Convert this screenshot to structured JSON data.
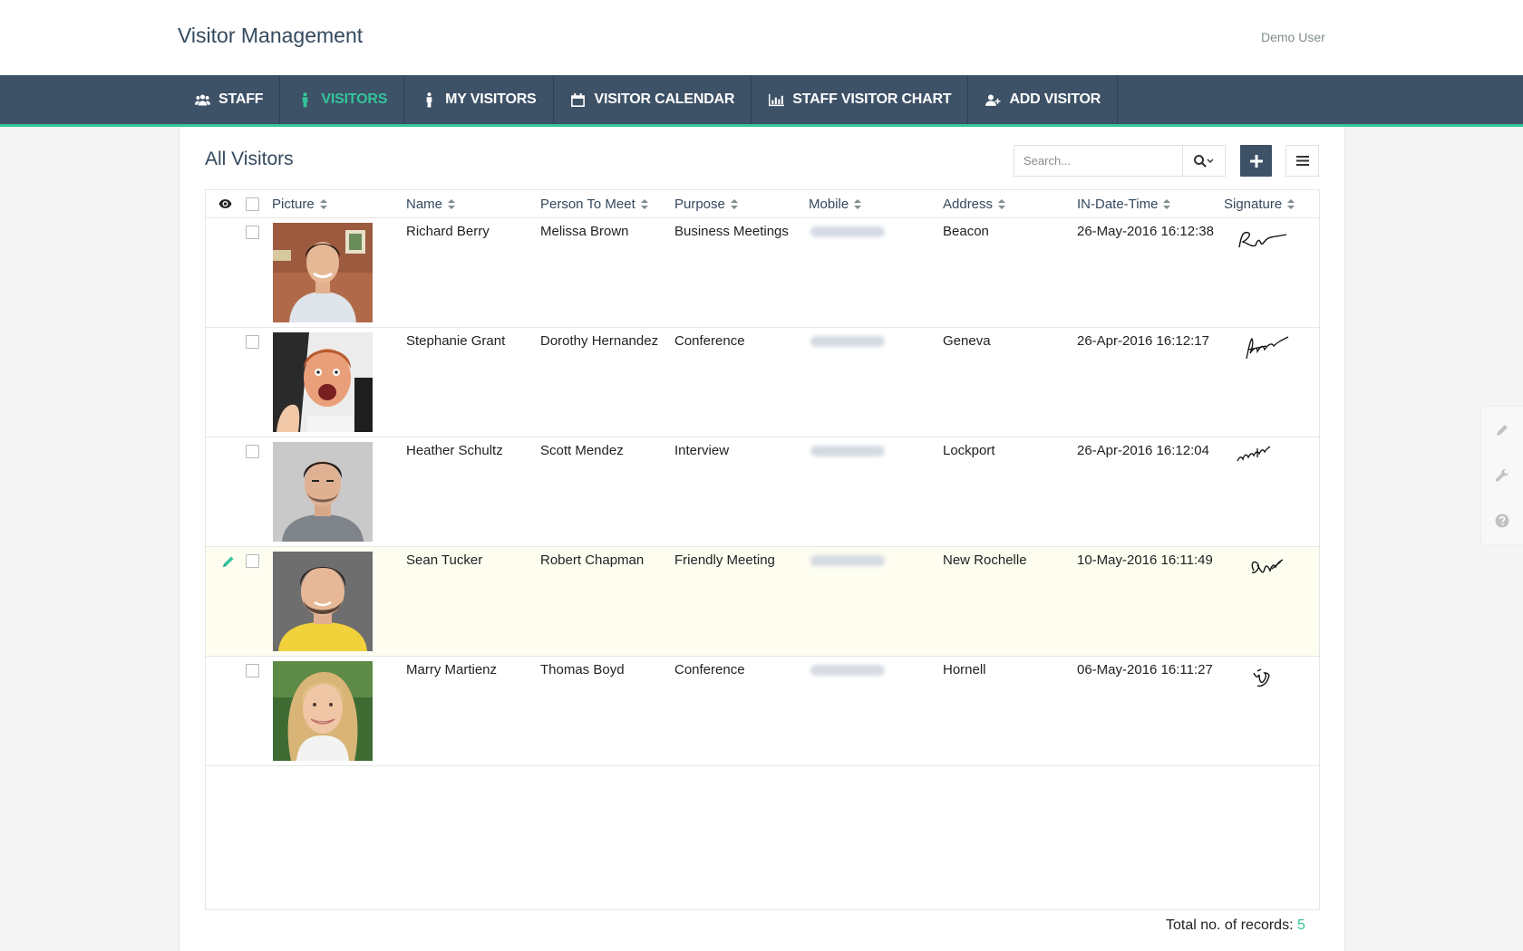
{
  "app": {
    "title": "Visitor Management",
    "user": "Demo User"
  },
  "nav": [
    {
      "label": "STAFF",
      "icon": "users-icon",
      "active": false
    },
    {
      "label": "VISITORS",
      "icon": "person-icon",
      "active": true
    },
    {
      "label": "MY VISITORS",
      "icon": "person-icon",
      "active": false
    },
    {
      "label": "VISITOR CALENDAR",
      "icon": "calendar-icon",
      "active": false
    },
    {
      "label": "STAFF VISITOR CHART",
      "icon": "bar-chart-icon",
      "active": false
    },
    {
      "label": "ADD VISITOR",
      "icon": "user-plus-icon",
      "active": false
    }
  ],
  "panel": {
    "title": "All Visitors",
    "search_placeholder": "Search...",
    "search_value": ""
  },
  "columns": [
    "Picture",
    "Name",
    "Person To Meet",
    "Purpose",
    "Mobile",
    "Address",
    "IN-Date-Time",
    "Signature"
  ],
  "rows": [
    {
      "name": "Richard Berry",
      "person_to_meet": "Melissa Brown",
      "purpose": "Business Meetings",
      "mobile": "6585346728",
      "address": "Beacon",
      "in_datetime": "26-May-2016 16:12:38",
      "highlighted": false,
      "checked": false
    },
    {
      "name": "Stephanie Grant",
      "person_to_meet": "Dorothy Hernandez",
      "purpose": "Conference",
      "mobile": "6587728286",
      "address": "Geneva",
      "in_datetime": "26-Apr-2016 16:12:17",
      "highlighted": false,
      "checked": false
    },
    {
      "name": "Heather Schultz",
      "person_to_meet": "Scott Mendez",
      "purpose": "Interview",
      "mobile": "6585728874",
      "address": "Lockport",
      "in_datetime": "26-Apr-2016 16:12:04",
      "highlighted": false,
      "checked": false
    },
    {
      "name": "Sean Tucker",
      "person_to_meet": "Robert Chapman",
      "purpose": "Friendly Meeting",
      "mobile": "7686625678",
      "address": "New Rochelle",
      "in_datetime": "10-May-2016 16:11:49",
      "highlighted": true,
      "checked": false
    },
    {
      "name": "Marry Martienz",
      "person_to_meet": "Thomas Boyd",
      "purpose": "Conference",
      "mobile": "6798544330",
      "address": "Hornell",
      "in_datetime": "06-May-2016 16:11:27",
      "highlighted": false,
      "checked": false
    }
  ],
  "footer": {
    "total_label": "Total no. of records:",
    "total_count": "5"
  },
  "side_tools": [
    "pencil-icon",
    "wrench-icon",
    "help-icon"
  ],
  "colors": {
    "navbar": "#3d5167",
    "accent": "#33c49a",
    "highlight_row": "#fdfdf0"
  }
}
